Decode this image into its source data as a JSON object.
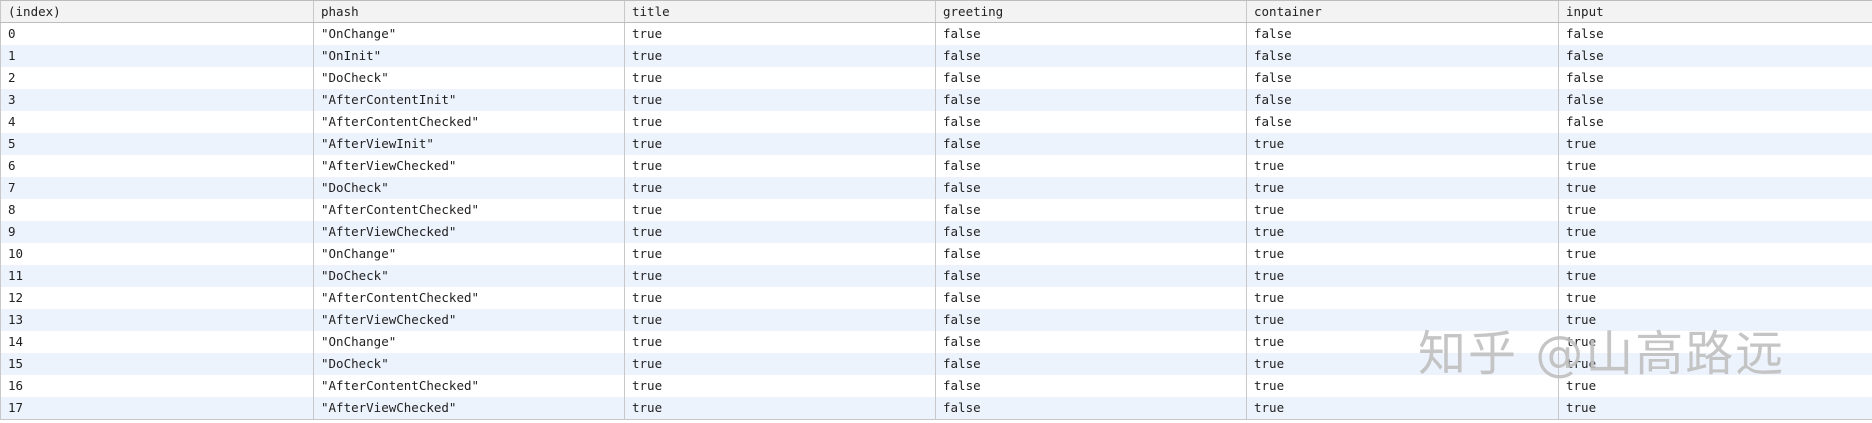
{
  "table": {
    "columns": [
      "(index)",
      "phash",
      "title",
      "greeting",
      "container",
      "input"
    ],
    "rows": [
      {
        "index": "0",
        "phash": "\"OnChange\"",
        "title": "true",
        "greeting": "false",
        "container": "false",
        "input": "false"
      },
      {
        "index": "1",
        "phash": "\"OnInit\"",
        "title": "true",
        "greeting": "false",
        "container": "false",
        "input": "false"
      },
      {
        "index": "2",
        "phash": "\"DoCheck\"",
        "title": "true",
        "greeting": "false",
        "container": "false",
        "input": "false"
      },
      {
        "index": "3",
        "phash": "\"AfterContentInit\"",
        "title": "true",
        "greeting": "false",
        "container": "false",
        "input": "false"
      },
      {
        "index": "4",
        "phash": "\"AfterContentChecked\"",
        "title": "true",
        "greeting": "false",
        "container": "false",
        "input": "false"
      },
      {
        "index": "5",
        "phash": "\"AfterViewInit\"",
        "title": "true",
        "greeting": "false",
        "container": "true",
        "input": "true"
      },
      {
        "index": "6",
        "phash": "\"AfterViewChecked\"",
        "title": "true",
        "greeting": "false",
        "container": "true",
        "input": "true"
      },
      {
        "index": "7",
        "phash": "\"DoCheck\"",
        "title": "true",
        "greeting": "false",
        "container": "true",
        "input": "true"
      },
      {
        "index": "8",
        "phash": "\"AfterContentChecked\"",
        "title": "true",
        "greeting": "false",
        "container": "true",
        "input": "true"
      },
      {
        "index": "9",
        "phash": "\"AfterViewChecked\"",
        "title": "true",
        "greeting": "false",
        "container": "true",
        "input": "true"
      },
      {
        "index": "10",
        "phash": "\"OnChange\"",
        "title": "true",
        "greeting": "false",
        "container": "true",
        "input": "true"
      },
      {
        "index": "11",
        "phash": "\"DoCheck\"",
        "title": "true",
        "greeting": "false",
        "container": "true",
        "input": "true"
      },
      {
        "index": "12",
        "phash": "\"AfterContentChecked\"",
        "title": "true",
        "greeting": "false",
        "container": "true",
        "input": "true"
      },
      {
        "index": "13",
        "phash": "\"AfterViewChecked\"",
        "title": "true",
        "greeting": "false",
        "container": "true",
        "input": "true"
      },
      {
        "index": "14",
        "phash": "\"OnChange\"",
        "title": "true",
        "greeting": "false",
        "container": "true",
        "input": "true"
      },
      {
        "index": "15",
        "phash": "\"DoCheck\"",
        "title": "true",
        "greeting": "false",
        "container": "true",
        "input": "true"
      },
      {
        "index": "16",
        "phash": "\"AfterContentChecked\"",
        "title": "true",
        "greeting": "false",
        "container": "true",
        "input": "true"
      },
      {
        "index": "17",
        "phash": "\"AfterViewChecked\"",
        "title": "true",
        "greeting": "false",
        "container": "true",
        "input": "true"
      }
    ]
  },
  "watermark": "知乎 @山高路远",
  "colors": {
    "string": "#a31515",
    "boolean": "#1a1aa6",
    "stripe": "#edf3fd",
    "header_bg": "#f3f3f3"
  }
}
